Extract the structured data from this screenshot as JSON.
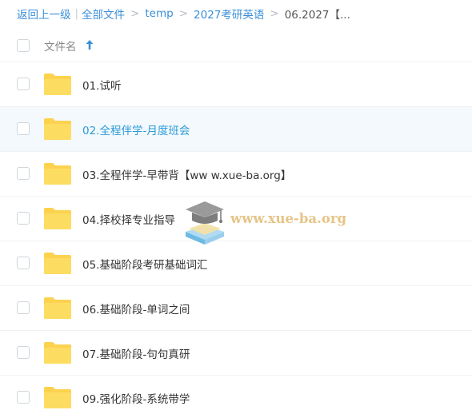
{
  "breadcrumb": {
    "back": "返回上一级",
    "items": [
      "全部文件",
      "temp",
      "2027考研英语",
      "06.2027【..."
    ]
  },
  "header": {
    "name_label": "文件名"
  },
  "rows": [
    {
      "name": "01.试听"
    },
    {
      "name": "02.全程伴学-月度班会"
    },
    {
      "name": "03.全程伴学-早带背【ww w.xue-ba.org】"
    },
    {
      "name": "04.择校择专业指导"
    },
    {
      "name": "05.基础阶段考研基础词汇"
    },
    {
      "name": "06.基础阶段-单词之间"
    },
    {
      "name": "07.基础阶段-句句真研"
    },
    {
      "name": "09.强化阶段-系统带学"
    }
  ],
  "watermark": {
    "text": "www.xue-ba.org"
  },
  "colors": {
    "link": "#3b8fd9",
    "highlight_text": "#2a9ad8",
    "highlight_bg": "#f4f9fd",
    "folder": "#fcd24e"
  }
}
